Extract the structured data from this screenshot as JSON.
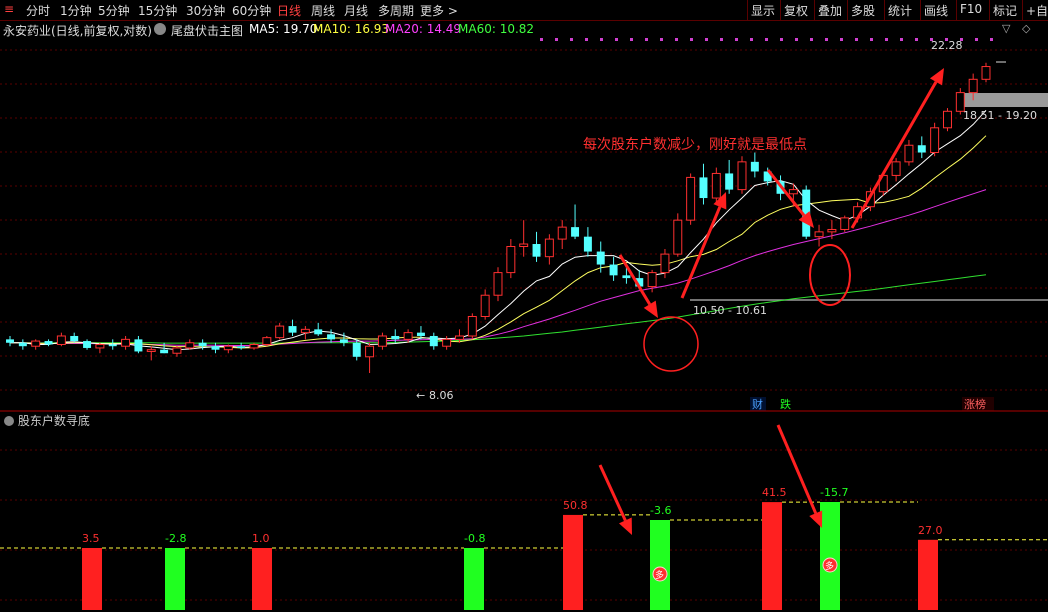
{
  "toolbar": {
    "periods": [
      "分时",
      "1分钟",
      "5分钟",
      "15分钟",
      "30分钟",
      "60分钟",
      "日线",
      "周线",
      "月线",
      "多周期",
      "更多 >"
    ],
    "active_period": "日线",
    "right_buttons": [
      "显示",
      "复权",
      "叠加",
      "多股",
      "统计",
      "画线",
      "F10",
      "标记",
      "+自选"
    ]
  },
  "stock": {
    "title": "永安药业(日线,前复权,对数)",
    "indicator_name": "尾盘伏击主图",
    "ma": [
      {
        "label": "MA5: 19.70",
        "color": "#ffffff"
      },
      {
        "label": "MA10: 16.93",
        "color": "#ffff40"
      },
      {
        "label": "MA20: 14.49",
        "color": "#ff40ff"
      },
      {
        "label": "MA60: 10.82",
        "color": "#40ff40"
      }
    ]
  },
  "annotations": {
    "main_text": "每次股东户数减少，刚好就是最低点",
    "price_high": "22.28",
    "price_low": "8.06",
    "range_upper": "18.51 - 19.20",
    "range_lower": "10.50 - 10.61",
    "badge_cai": "财",
    "badge_die": "跌",
    "badge_zhangbang": "涨榜"
  },
  "sub_chart": {
    "title": "股东户数寻底",
    "marker_glyph": "多"
  },
  "colors": {
    "up": "#ff3030",
    "down": "#54ffff",
    "grid": "#5a0000",
    "accent": "#ff3030"
  },
  "chart_data": [
    {
      "type": "candlestick",
      "title": "永安药业(日线,前复权,对数)",
      "price_range": [
        7.5,
        24
      ],
      "candles": [
        [
          9.0,
          9.1,
          8.8,
          8.9
        ],
        [
          8.9,
          9.0,
          8.7,
          8.8
        ],
        [
          8.8,
          9.0,
          8.7,
          8.95
        ],
        [
          8.95,
          9.0,
          8.8,
          8.85
        ],
        [
          8.85,
          9.2,
          8.8,
          9.1
        ],
        [
          9.1,
          9.2,
          8.9,
          8.95
        ],
        [
          8.95,
          9.0,
          8.7,
          8.75
        ],
        [
          8.75,
          8.9,
          8.6,
          8.85
        ],
        [
          8.85,
          9.0,
          8.7,
          8.8
        ],
        [
          8.8,
          9.1,
          8.7,
          9.0
        ],
        [
          9.0,
          9.1,
          8.6,
          8.65
        ],
        [
          8.65,
          8.8,
          8.4,
          8.7
        ],
        [
          8.7,
          8.9,
          8.6,
          8.6
        ],
        [
          8.6,
          8.8,
          8.5,
          8.75
        ],
        [
          8.75,
          9.0,
          8.7,
          8.9
        ],
        [
          8.9,
          9.0,
          8.7,
          8.8
        ],
        [
          8.8,
          8.9,
          8.6,
          8.7
        ],
        [
          8.7,
          8.85,
          8.6,
          8.8
        ],
        [
          8.8,
          8.9,
          8.7,
          8.75
        ],
        [
          8.75,
          8.9,
          8.7,
          8.85
        ],
        [
          8.85,
          9.1,
          8.8,
          9.05
        ],
        [
          9.05,
          9.5,
          9.0,
          9.4
        ],
        [
          9.4,
          9.6,
          9.1,
          9.2
        ],
        [
          9.2,
          9.4,
          9.0,
          9.3
        ],
        [
          9.3,
          9.5,
          9.1,
          9.15
        ],
        [
          9.15,
          9.3,
          8.9,
          9.0
        ],
        [
          9.0,
          9.2,
          8.8,
          8.9
        ],
        [
          8.9,
          9.0,
          8.4,
          8.5
        ],
        [
          8.5,
          8.9,
          8.06,
          8.8
        ],
        [
          8.8,
          9.2,
          8.7,
          9.1
        ],
        [
          9.1,
          9.3,
          8.9,
          9.0
        ],
        [
          9.0,
          9.3,
          8.9,
          9.2
        ],
        [
          9.2,
          9.4,
          9.0,
          9.1
        ],
        [
          9.1,
          9.2,
          8.7,
          8.8
        ],
        [
          8.8,
          9.1,
          8.7,
          9.0
        ],
        [
          9.0,
          9.3,
          8.9,
          9.1
        ],
        [
          9.1,
          9.8,
          9.0,
          9.7
        ],
        [
          9.7,
          10.6,
          9.6,
          10.4
        ],
        [
          10.4,
          11.4,
          10.2,
          11.2
        ],
        [
          11.2,
          12.5,
          11.0,
          12.2
        ],
        [
          12.2,
          13.3,
          11.8,
          12.3
        ],
        [
          12.3,
          12.8,
          11.6,
          11.8
        ],
        [
          11.8,
          12.7,
          11.5,
          12.5
        ],
        [
          12.5,
          13.3,
          12.1,
          13.0
        ],
        [
          13.0,
          14.0,
          12.5,
          12.6
        ],
        [
          12.6,
          13.0,
          11.8,
          12.0
        ],
        [
          12.0,
          12.4,
          11.2,
          11.5
        ],
        [
          11.5,
          11.8,
          10.9,
          11.1
        ],
        [
          11.1,
          11.4,
          10.8,
          11.0
        ],
        [
          11.0,
          11.3,
          10.6,
          10.7
        ],
        [
          10.7,
          11.3,
          10.5,
          11.2
        ],
        [
          11.2,
          12.1,
          11.0,
          11.9
        ],
        [
          11.9,
          13.6,
          11.8,
          13.3
        ],
        [
          13.3,
          15.5,
          13.1,
          15.3
        ],
        [
          15.3,
          16.0,
          14.0,
          14.3
        ],
        [
          14.3,
          15.8,
          14.1,
          15.5
        ],
        [
          15.5,
          16.2,
          14.5,
          14.7
        ],
        [
          14.7,
          16.4,
          14.5,
          16.1
        ],
        [
          16.1,
          16.6,
          15.3,
          15.6
        ],
        [
          15.6,
          15.8,
          14.9,
          15.1
        ],
        [
          15.1,
          15.4,
          14.2,
          14.5
        ],
        [
          14.5,
          15.0,
          13.9,
          14.7
        ],
        [
          14.7,
          14.9,
          12.5,
          12.6
        ],
        [
          12.6,
          13.1,
          12.2,
          12.8
        ],
        [
          12.8,
          13.3,
          12.5,
          12.9
        ],
        [
          12.9,
          13.5,
          12.8,
          13.4
        ],
        [
          13.4,
          14.1,
          13.2,
          13.9
        ],
        [
          13.9,
          14.8,
          13.7,
          14.6
        ],
        [
          14.6,
          15.6,
          14.4,
          15.4
        ],
        [
          15.4,
          16.3,
          15.1,
          16.1
        ],
        [
          16.1,
          17.3,
          15.9,
          17.0
        ],
        [
          17.0,
          17.5,
          16.3,
          16.6
        ],
        [
          16.6,
          18.3,
          16.4,
          18.0
        ],
        [
          18.0,
          19.2,
          17.8,
          19.0
        ],
        [
          19.0,
          20.5,
          18.8,
          20.2
        ],
        [
          20.2,
          21.5,
          19.7,
          21.1
        ],
        [
          21.1,
          22.28,
          20.9,
          22.0
        ]
      ],
      "ma5": [
        8.9,
        8.9,
        8.85,
        8.85,
        8.92,
        8.93,
        8.9,
        8.87,
        8.86,
        8.87,
        8.81,
        8.78,
        8.74,
        8.7,
        8.72,
        8.76,
        8.79,
        8.8,
        8.77,
        8.78,
        8.85,
        8.97,
        9.05,
        9.18,
        9.25,
        9.21,
        9.11,
        8.98,
        8.85,
        8.86,
        8.88,
        8.92,
        9.04,
        9.04,
        9.02,
        9.04,
        9.16,
        9.4,
        9.76,
        10.12,
        10.54,
        10.9,
        11.06,
        11.52,
        11.78,
        11.84,
        11.84,
        11.84,
        11.64,
        11.26,
        11.1,
        11.18,
        11.42,
        11.96,
        12.5,
        13.18,
        13.76,
        14.3,
        14.9,
        15.04,
        15.14,
        14.96,
        14.2,
        13.74,
        13.5,
        13.28,
        13.52,
        13.92,
        14.44,
        14.94,
        15.48,
        16.02,
        16.62,
        17.08,
        17.54,
        18.2,
        19.06
      ],
      "ma10": [
        8.9,
        8.9,
        8.88,
        8.87,
        8.89,
        8.9,
        8.9,
        8.88,
        8.88,
        8.88,
        8.87,
        8.84,
        8.81,
        8.79,
        8.79,
        8.78,
        8.78,
        8.77,
        8.75,
        8.76,
        8.8,
        8.87,
        8.92,
        8.97,
        9.01,
        9.04,
        9.04,
        9.02,
        9.01,
        9.01,
        9.04,
        9.06,
        9.06,
        9.01,
        8.95,
        8.93,
        8.99,
        9.12,
        9.3,
        9.53,
        9.79,
        10.0,
        10.23,
        10.56,
        10.9,
        11.2,
        11.38,
        11.45,
        11.58,
        11.52,
        11.47,
        11.51,
        11.64,
        11.8,
        11.89,
        12.08,
        12.4,
        12.7,
        13.2,
        13.52,
        13.78,
        13.94,
        14.02,
        14.09,
        14.17,
        14.21,
        14.24,
        14.06,
        14.09,
        14.22,
        14.38,
        14.77,
        15.27,
        15.76,
        16.24,
        16.85,
        17.54
      ],
      "ma20": [
        8.9,
        8.9,
        8.89,
        8.88,
        8.88,
        8.88,
        8.88,
        8.87,
        8.86,
        8.86,
        8.86,
        8.85,
        8.84,
        8.83,
        8.83,
        8.83,
        8.83,
        8.82,
        8.82,
        8.82,
        8.84,
        8.86,
        8.88,
        8.9,
        8.92,
        8.93,
        8.94,
        8.95,
        8.95,
        8.96,
        8.97,
        8.98,
        8.99,
        9.0,
        9.0,
        9.0,
        9.02,
        9.07,
        9.15,
        9.25,
        9.38,
        9.5,
        9.62,
        9.76,
        9.9,
        10.05,
        10.2,
        10.32,
        10.44,
        10.56,
        10.64,
        10.72,
        10.82,
        10.96,
        11.12,
        11.28,
        11.46,
        11.66,
        11.84,
        12.0,
        12.14,
        12.28,
        12.4,
        12.52,
        12.64,
        12.76,
        12.9,
        13.04,
        13.2,
        13.36,
        13.52,
        13.7,
        13.9,
        14.1,
        14.3,
        14.5,
        14.7
      ],
      "ma60": [
        8.9,
        8.9,
        8.9,
        8.9,
        8.9,
        8.9,
        8.9,
        8.9,
        8.9,
        8.9,
        8.9,
        8.9,
        8.89,
        8.89,
        8.89,
        8.89,
        8.89,
        8.89,
        8.89,
        8.89,
        8.89,
        8.89,
        8.9,
        8.9,
        8.9,
        8.9,
        8.9,
        8.9,
        8.9,
        8.9,
        8.91,
        8.92,
        8.93,
        8.94,
        8.95,
        8.97,
        8.99,
        9.01,
        9.04,
        9.07,
        9.1,
        9.14,
        9.18,
        9.22,
        9.27,
        9.32,
        9.37,
        9.42,
        9.47,
        9.52,
        9.57,
        9.62,
        9.68,
        9.75,
        9.82,
        9.89,
        9.96,
        10.03,
        10.1,
        10.16,
        10.22,
        10.28,
        10.33,
        10.38,
        10.43,
        10.48,
        10.53,
        10.58,
        10.64,
        10.7,
        10.76,
        10.82,
        10.88,
        10.94,
        11.0,
        11.06,
        11.12
      ]
    },
    {
      "type": "bar",
      "title": "股东户数寻底",
      "bars": [
        {
          "value": 3.5,
          "label": "3.5",
          "color": "#ff2020"
        },
        {
          "value": -2.8,
          "label": "-2.8",
          "color": "#20ff20"
        },
        {
          "value": 1.0,
          "label": "1.0",
          "color": "#ff2020"
        },
        {
          "value": -0.8,
          "label": "-0.8",
          "color": "#20ff20"
        },
        {
          "value": 50.8,
          "label": "50.8",
          "color": "#ff2020"
        },
        {
          "value": -3.6,
          "label": "-3.6",
          "color": "#20ff20"
        },
        {
          "value": 41.5,
          "label": "41.5",
          "color": "#ff2020"
        },
        {
          "value": -15.7,
          "label": "-15.7",
          "color": "#20ff20"
        },
        {
          "value": 27.0,
          "label": "27.0",
          "color": "#ff2020"
        }
      ]
    }
  ]
}
